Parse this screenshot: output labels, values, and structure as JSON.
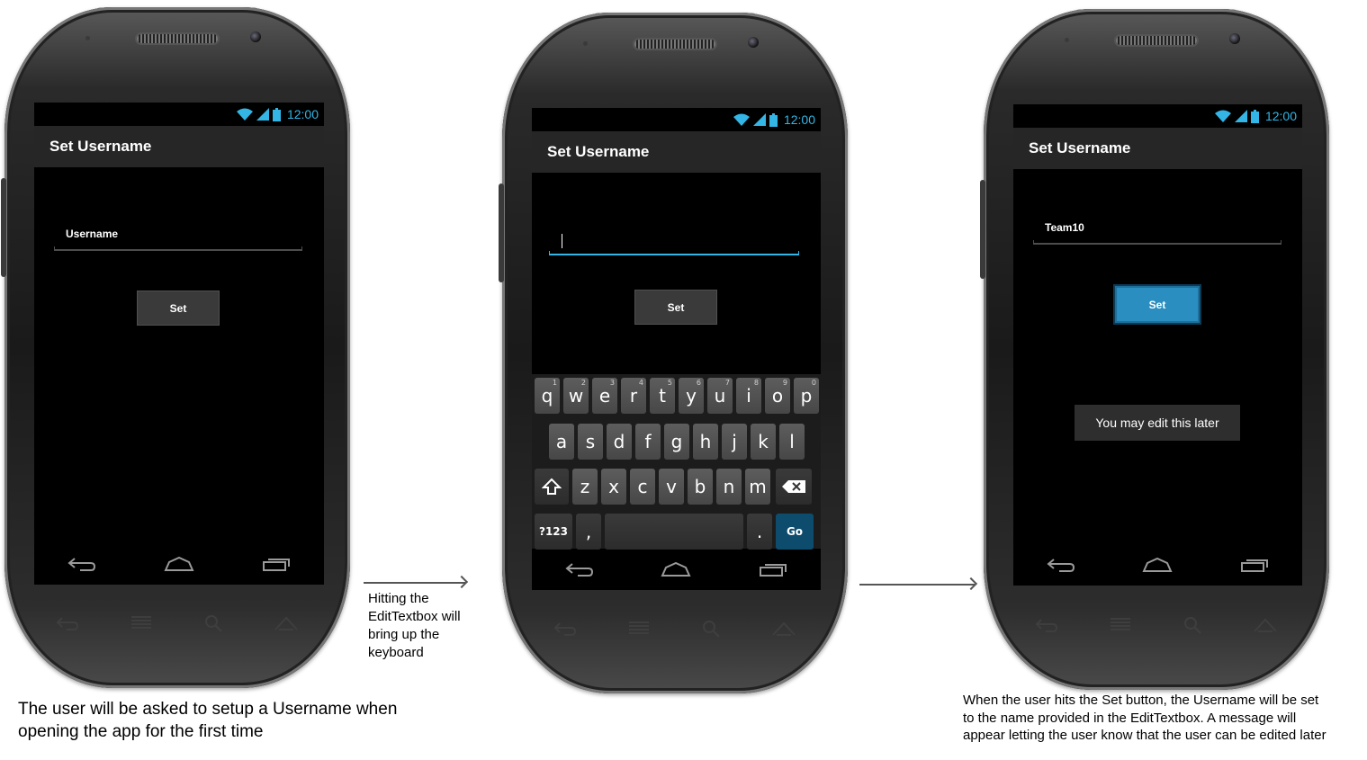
{
  "status": {
    "time": "12:00"
  },
  "screens": [
    {
      "title": "Set Username",
      "input_value": "Username",
      "button_label": "Set"
    },
    {
      "title": "Set Username",
      "input_value": "",
      "button_label": "Set",
      "keyboard": {
        "row1": [
          {
            "k": "q",
            "h": "1"
          },
          {
            "k": "w",
            "h": "2"
          },
          {
            "k": "e",
            "h": "3"
          },
          {
            "k": "r",
            "h": "4"
          },
          {
            "k": "t",
            "h": "5"
          },
          {
            "k": "y",
            "h": "6"
          },
          {
            "k": "u",
            "h": "7"
          },
          {
            "k": "i",
            "h": "8"
          },
          {
            "k": "o",
            "h": "9"
          },
          {
            "k": "p",
            "h": "0"
          }
        ],
        "row2": [
          "a",
          "s",
          "d",
          "f",
          "g",
          "h",
          "j",
          "k",
          "l"
        ],
        "row3": [
          "z",
          "x",
          "c",
          "v",
          "b",
          "n",
          "m"
        ],
        "symbols_label": "?123",
        "comma_label": ",",
        "period_label": ".",
        "go_label": "Go"
      }
    },
    {
      "title": "Set Username",
      "input_value": "Team10",
      "button_label": "Set",
      "toast": "You may edit this later"
    }
  ],
  "annotations": {
    "arrow1_caption": "Hitting the EditTextbox will bring up the keyboard",
    "arrow1_lines": [
      "Hitting the",
      "EditTextbox will",
      "bring up the",
      "keyboard"
    ],
    "bottom_left_lines": [
      "The user will be asked to setup a Username when",
      "opening the app for the first time"
    ],
    "bottom_right_lines": [
      "When the user hits the Set button, the Username will be set",
      "to the name provided in the EditTextbox. A message will",
      "appear letting the user know that the user can be edited later"
    ]
  },
  "colors": {
    "accent": "#33b5e5",
    "pressed_button": "#2a8fc0",
    "go_key": "#0e4c6e"
  },
  "icons": [
    "wifi-icon",
    "signal-icon",
    "battery-icon",
    "back-icon",
    "home-icon",
    "recent-apps-icon",
    "hw-back-icon",
    "hw-menu-icon",
    "hw-search-icon",
    "hw-home-icon",
    "shift-icon",
    "backspace-icon"
  ]
}
